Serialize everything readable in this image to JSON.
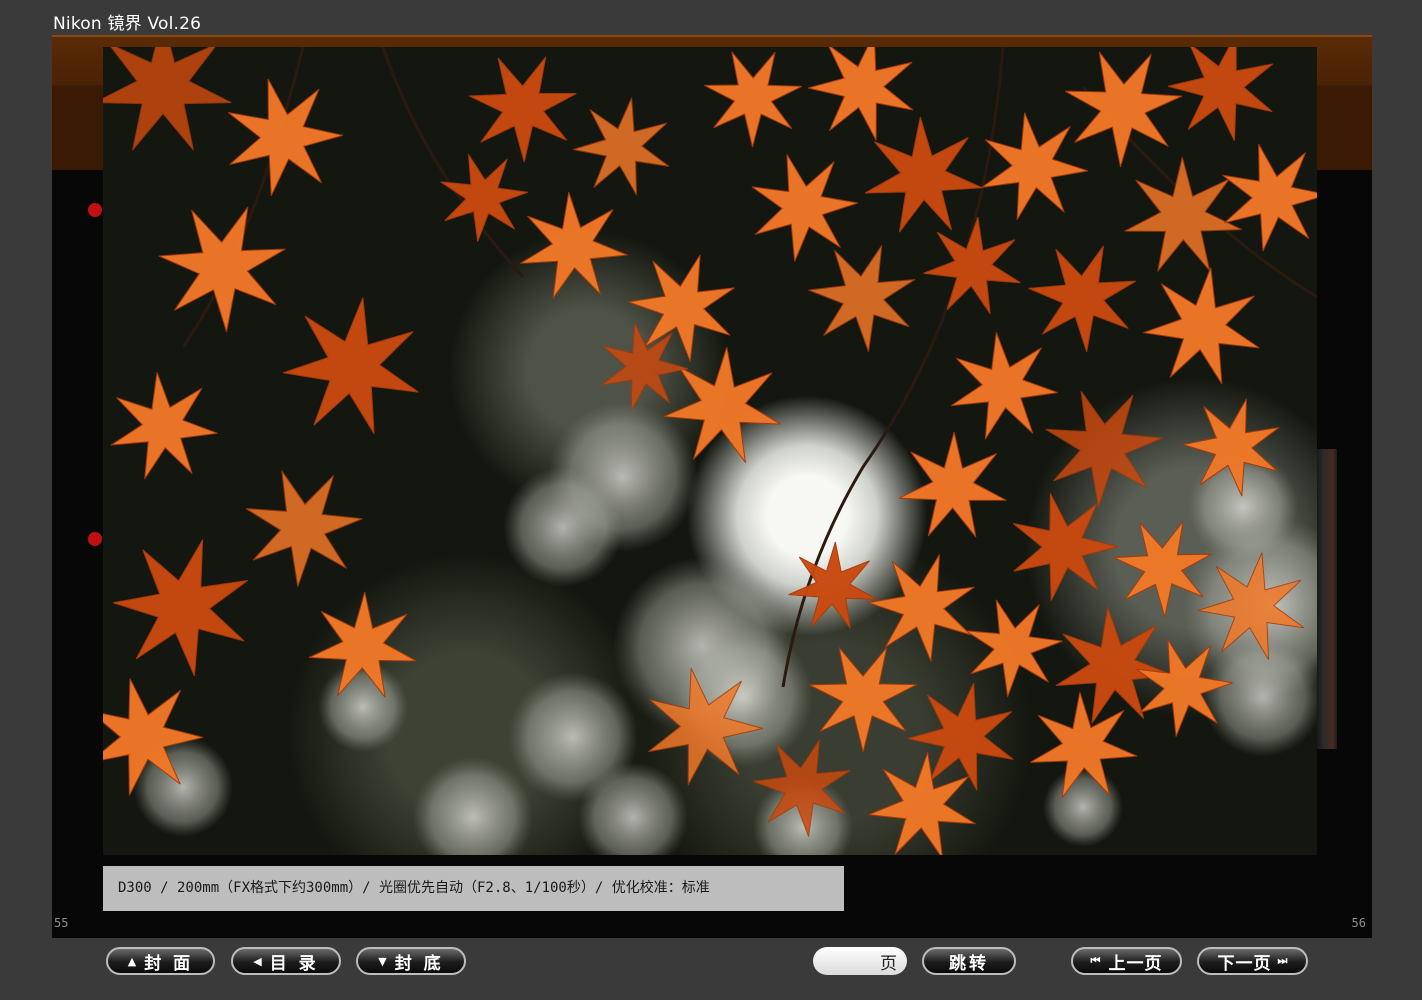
{
  "app": {
    "title": "Nikon 镜界 Vol.26"
  },
  "book": {
    "left_page_number": "55",
    "right_page_number": "56"
  },
  "photo": {
    "caption": "D300 / 200mm（FX格式下约300mm）/ 光圈优先自动（F2.8、1/100秒）/ 优化校准：标准"
  },
  "nav": {
    "cover_label": "封 面",
    "toc_label": "目 录",
    "back_cover_label": "封 底",
    "page_suffix": "页",
    "jump_label": "跳转",
    "prev_label": "上一页",
    "next_label": "下一页"
  },
  "colors": {
    "leaf_orange": "#f07828",
    "leaf_dark": "#c84a10",
    "caption_bg": "#bdbdbd",
    "window_bg": "#3a3a3a"
  }
}
